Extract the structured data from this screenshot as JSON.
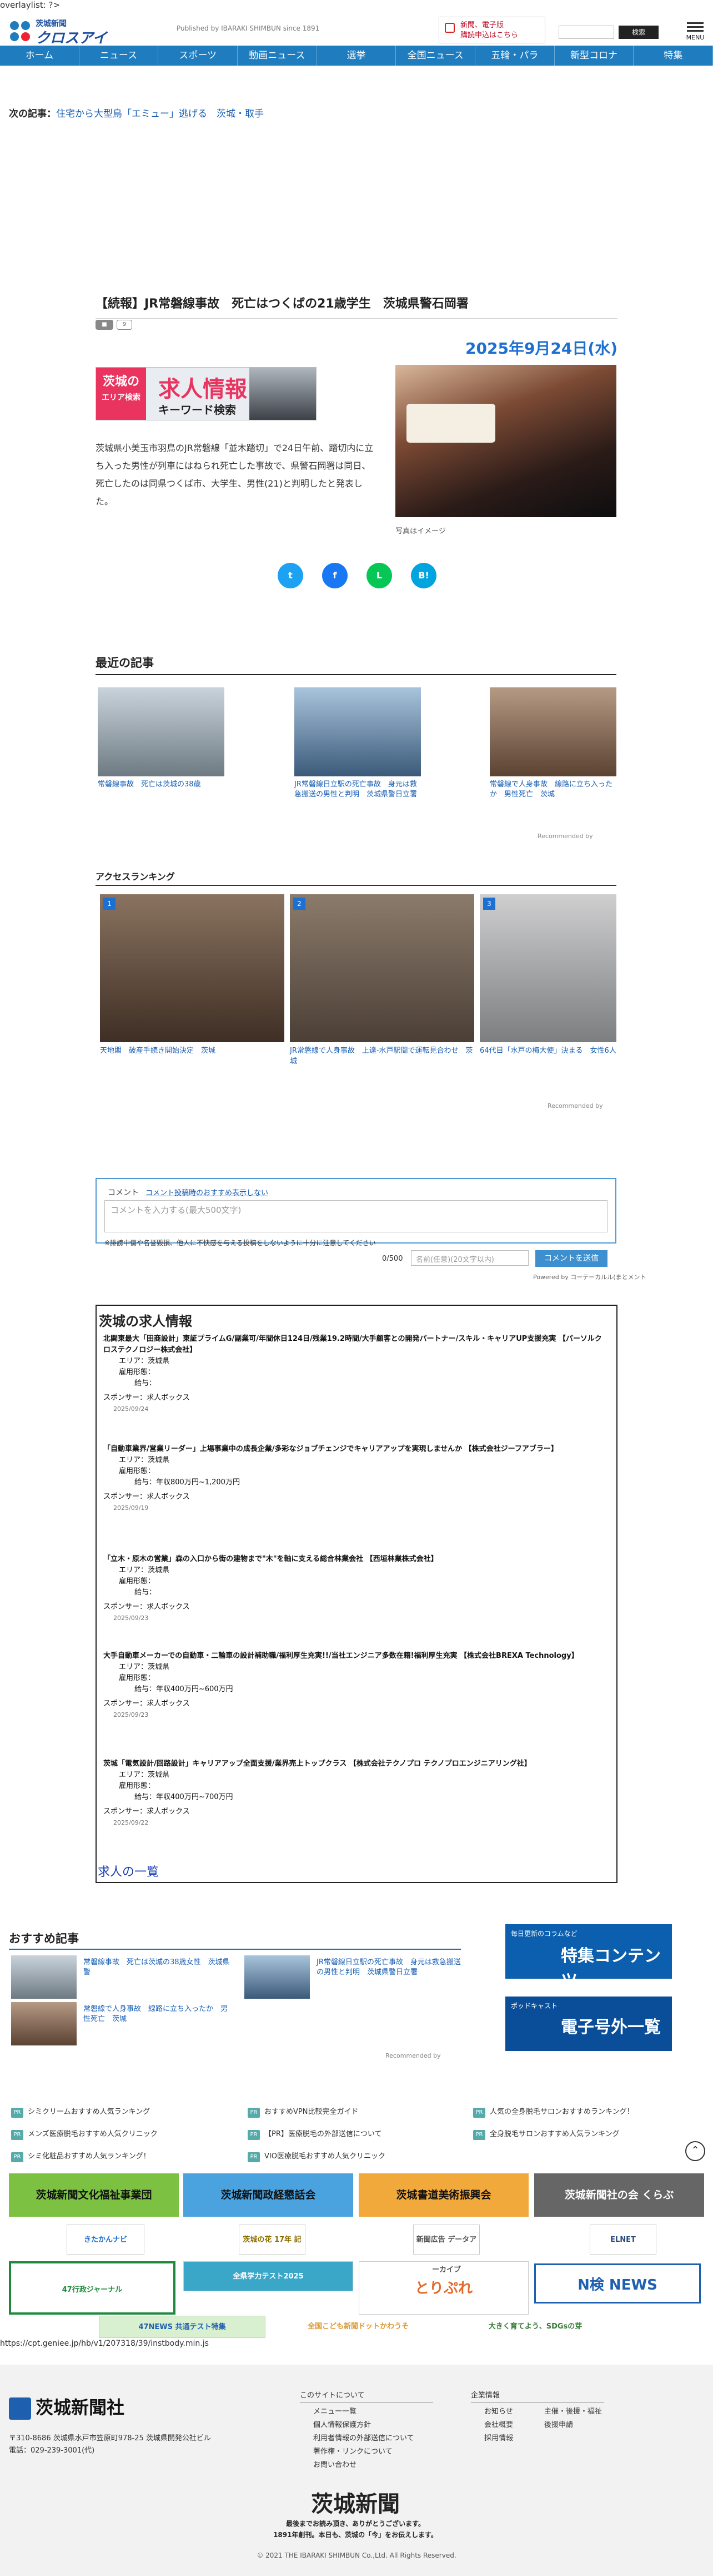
{
  "debug": "overlaylist: ?>",
  "header": {
    "logo_line1": "茨城新聞",
    "logo_line2": "クロスアイ",
    "publisher": "Published by IBARAKI SHIMBUN since 1891",
    "sub_line1": "新聞、電子版",
    "sub_line2": "購読申込はこちら",
    "search_button": "検索",
    "menu_label": "MENU"
  },
  "nav": [
    "ホーム",
    "ニュース",
    "スポーツ",
    "動画ニュース",
    "選挙",
    "全国ニュース",
    "五輪・パラ",
    "新型コロナ",
    "特集"
  ],
  "next": {
    "label": "次の記事：",
    "title": "住宅から大型鳥「エミュー」逃げる　茨城・取手"
  },
  "article": {
    "title": "【続報】JR常磐線事故　死亡はつくばの21歳学生　茨城県警石岡署",
    "tag1": "",
    "tag2": "9",
    "date": "2025年9月24日(水)",
    "body": "茨城県小美玉市羽鳥のJR常磐線「並木踏切」で24日午前、踏切内に立ち入った男性が列車にはねられ死亡した事故で、県警石岡署は同日、死亡したのは同県つくば市、大学生、男性(21)と判明したと発表した。",
    "caption": "写真はイメージ"
  },
  "ad": {
    "line1": "茨城の",
    "line2": "エリア検索",
    "big": "求人情報",
    "kw": "キーワード検索"
  },
  "share": [
    "t",
    "f",
    "L",
    "B!"
  ],
  "recent": {
    "heading": "最近の記事",
    "items": [
      "常磐線事故　死亡は茨城の38歳",
      "JR常磐線日立駅の死亡事故　身元は救急搬送の男性と判明　茨城県警日立署",
      "常磐線で人身事故　線路に立ち入ったか　男性死亡　茨城"
    ],
    "recommended": "Recommended by"
  },
  "ranking": {
    "heading": "アクセスランキング",
    "items": [
      {
        "num": "1",
        "title": "天地閣　破産手続き開始決定　茨城"
      },
      {
        "num": "2",
        "title": "JR常磐線で人身事故　上達-水戸駅間で運転見合わせ　茨城"
      },
      {
        "num": "3",
        "title": "64代目「水戸の梅大使」決まる　女性6人"
      }
    ],
    "recommended": "Recommended by"
  },
  "comments": {
    "label": "コメント",
    "link": "コメント投稿時のおすすめ表示しない",
    "placeholder": "コメントを入力する(最大500文字)",
    "note": "※誹謗中傷や名誉毀損、他人に不快感を与える投稿をしないように十分に注意してください",
    "count": "0/500",
    "name_placeholder": "名前(任意)(20文字以内)",
    "submit": "コメントを送信",
    "powered": "Powered by コーテーカルル(まとメント"
  },
  "jobs": {
    "heading": "茨城の求人情報",
    "labels": {
      "area": "エリア：",
      "type": "雇用形態：",
      "pay": "給与：",
      "sponsor": "スポンサー："
    },
    "items": [
      {
        "title": "北関東最大「田商設計」東証プライムG/副業可/年間休日124日/残業19.2時間/大手顧客との開発パートナー/スキル・キャリアUP支援充実 【パーソルクロステクノロジー株式会社】",
        "area": "茨城県",
        "type": "",
        "pay": "",
        "sponsor": "求人ボックス",
        "date": "2025/09/24"
      },
      {
        "title": "「自動車業界/営業リーダー」上場事業中の成長企業/多彩なジョブチェンジでキャリアアップを実現しませんか 【株式会社ジーフアブラー】",
        "area": "茨城県",
        "type": "",
        "pay": "年収800万円~1,200万円",
        "sponsor": "求人ボックス",
        "date": "2025/09/19"
      },
      {
        "title": "「立木・原木の営業」森の入口から街の建物まで\"木\"を軸に支える総合林業会社 【西垣林業株式会社】",
        "area": "茨城県",
        "type": "",
        "pay": "",
        "sponsor": "求人ボックス",
        "date": "2025/09/23"
      },
      {
        "title": "大手自動車メーカーでの自動車・二輪車の設計補助職/福利厚生充実!!/当社エンジニア多数在籍!福利厚生充実 【株式会社BREXA Technology】",
        "area": "茨城県",
        "type": "",
        "pay": "年収400万円~600万円",
        "sponsor": "求人ボックス",
        "date": "2025/09/23"
      },
      {
        "title": "茨城「電気設計/回路設計」キャリアアップ全面支援/業界売上トップクラス 【株式会社テクノプロ テクノプロエンジニアリング社】",
        "area": "茨城県",
        "type": "",
        "pay": "年収400万円~700万円",
        "sponsor": "求人ボックス",
        "date": "2025/09/22"
      }
    ],
    "more": "求人の一覧"
  },
  "osusume": {
    "heading": "おすすめ記事",
    "items": [
      "常磐線事故　死亡は茨城の38歳女性　茨城県警",
      "JR常磐線日立駅の死亡事故　身元は救急搬送の男性と判明　茨城県警日立署",
      "常磐線で人身事故　線路に立ち入ったか　男性死亡　茨城"
    ],
    "recommended": "Recommended by"
  },
  "banners": {
    "b1_top": "毎日更新のコラムなど",
    "b1_main": "特集コンテンツ",
    "b2_top": "ポッドキャスト",
    "b2_main": "電子号外一覧"
  },
  "links": [
    "シミクリームおすすめ人気ランキング",
    "おすすめVPN比較完全ガイド",
    "人気の全身脱毛サロンおすすめランキング！",
    "メンズ医療脱毛おすすめ人気クリニック",
    "【PR】医療脱毛の外部送信について",
    "全身脱毛サロンおすすめ人気ランキング",
    "シミ化粧品おすすめ人気ランキング！",
    "VIO医療脱毛おすすめ人気クリニック"
  ],
  "bigbuttons": [
    "茨城新聞文化福祉事業団",
    "茨城新聞政経懇話会",
    "茨城書道美術振興会",
    "茨城新聞社の会 くらぶ"
  ],
  "sponsors": [
    "きたかんナビ",
    "茨城の花 17年 記念企画",
    "新聞広告 データアーカイブ",
    "ELNET",
    "47行政ジャーナル",
    "全県学力テスト2025",
    "とりぷれ",
    "N検 NEWS",
    "47NEWS 共通テスト特集",
    "全国こども新聞ドットかわうそ",
    "大きく育てよう、SDGsの芽"
  ],
  "url": "https://cpt.geniee.jp/hb/v1/207318/39/instbody.min.js",
  "footer": {
    "brand": "茨城新聞社",
    "addr1": "〒310-8686 茨城県水戸市笠原町978-25 茨城県開発公社ビル",
    "addr2": "電話：029-239-3001(代)",
    "col1": {
      "head": "このサイトについて",
      "items": [
        "メニュー一覧",
        "個人情報保護方針",
        "利用者情報の外部送信について",
        "著作権・リンクについて",
        "お問い合わせ"
      ]
    },
    "col2": {
      "head": "企業情報",
      "items": [
        "お知らせ",
        "主催・後援・福祉",
        "会社概要",
        "後援申請",
        "採用情報"
      ]
    },
    "seal": "茨城新聞",
    "msg1": "最後までお読み頂き、ありがとうございます。",
    "msg2": "1891年創刊。本日も、茨城の「今」をお伝えします。",
    "copy": "© 2021 THE IBARAKI SHIMBUN Co.,Ltd. All Rights Reserved."
  },
  "colors": {
    "nav": "#1e7cbf",
    "accent": "#1e6fd2",
    "twitter": "#1da1f2",
    "facebook": "#1877f2",
    "line": "#06c755",
    "hatena": "#00a4de",
    "green": "#5cb531",
    "blue": "#4aa3df",
    "orange": "#f2a93b",
    "gray": "#666666"
  }
}
